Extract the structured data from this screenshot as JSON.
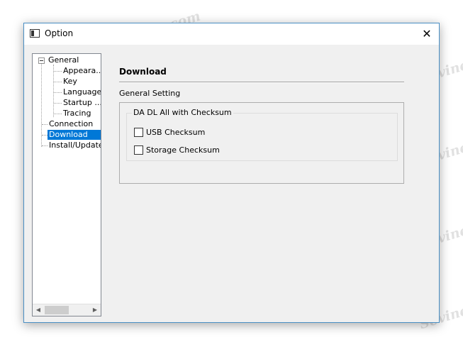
{
  "window": {
    "title": "Option",
    "close_glyph": "✕"
  },
  "tree": {
    "items": [
      {
        "label": "General"
      },
      {
        "label": "Appeara..."
      },
      {
        "label": "Key"
      },
      {
        "label": "Language"
      },
      {
        "label": "Startup ..."
      },
      {
        "label": "Tracing"
      },
      {
        "label": "Connection"
      },
      {
        "label": "Download"
      },
      {
        "label": "Install/Update"
      }
    ],
    "selected": "Download",
    "scroll_left_glyph": "◀",
    "scroll_right_glyph": "▶"
  },
  "panel": {
    "title": "Download",
    "section_label": "General Setting",
    "group": {
      "label": "DA DL All with Checksum",
      "options": [
        {
          "label": "USB Checksum",
          "checked": false
        },
        {
          "label": "Storage Checksum",
          "checked": false
        }
      ]
    }
  },
  "watermark": {
    "text": "Sovinesvepair.com"
  },
  "colors": {
    "selection": "#0078d7",
    "window_border": "#4a8fc4",
    "background": "#f0f0f0"
  }
}
